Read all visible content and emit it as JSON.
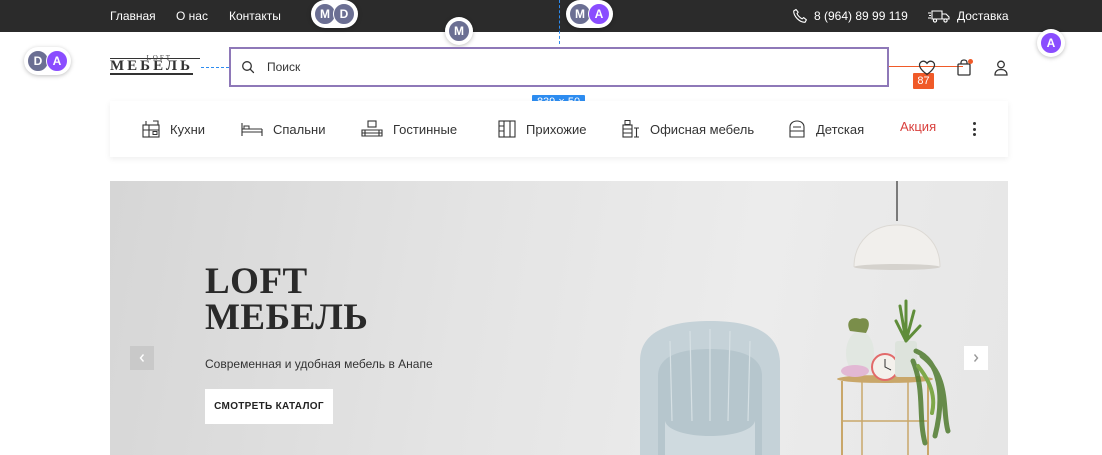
{
  "top_nav": {
    "links": [
      "Главная",
      "О нас",
      "Контакты"
    ],
    "phone": "8 (964) 89 99 119",
    "delivery": "Доставка"
  },
  "collaborators": {
    "group_top_left": [
      "M",
      "D"
    ],
    "group_top_center": [
      "M",
      "A"
    ],
    "group_left": [
      "D",
      "A"
    ],
    "cursor_search": "M",
    "cursor_right": "A"
  },
  "logo": {
    "small_text": "LOFT",
    "big_text": "МЕБЕЛЬ"
  },
  "search": {
    "placeholder": "Поиск",
    "dimension_label": "839 × 50"
  },
  "measurement_badge": "87",
  "categories": [
    {
      "label": "Кухни",
      "icon": "kitchen-icon"
    },
    {
      "label": "Спальни",
      "icon": "bed-icon"
    },
    {
      "label": "Гостинные",
      "icon": "living-room-icon"
    },
    {
      "label": "Прихожие",
      "icon": "wardrobe-icon"
    },
    {
      "label": "Офисная мебель",
      "icon": "office-furniture-icon"
    },
    {
      "label": "Детская",
      "icon": "kids-room-icon"
    },
    {
      "label": "Акция",
      "icon": ""
    }
  ],
  "hero": {
    "title_line1": "LOFT",
    "title_line2": "МЕБЕЛЬ",
    "subtitle": "Современная и удобная мебель в Анапе",
    "button": "СМОТРЕТЬ КАТАЛОГ"
  },
  "colors": {
    "top_bar": "#2b2b2b",
    "selection_border": "#8e78b8",
    "guide_blue": "#2d8cf0",
    "measure_orange": "#f05a28",
    "sale_red": "#d9403d",
    "avatar_slate": "#6b6f93",
    "avatar_purple": "#8a4dff"
  }
}
